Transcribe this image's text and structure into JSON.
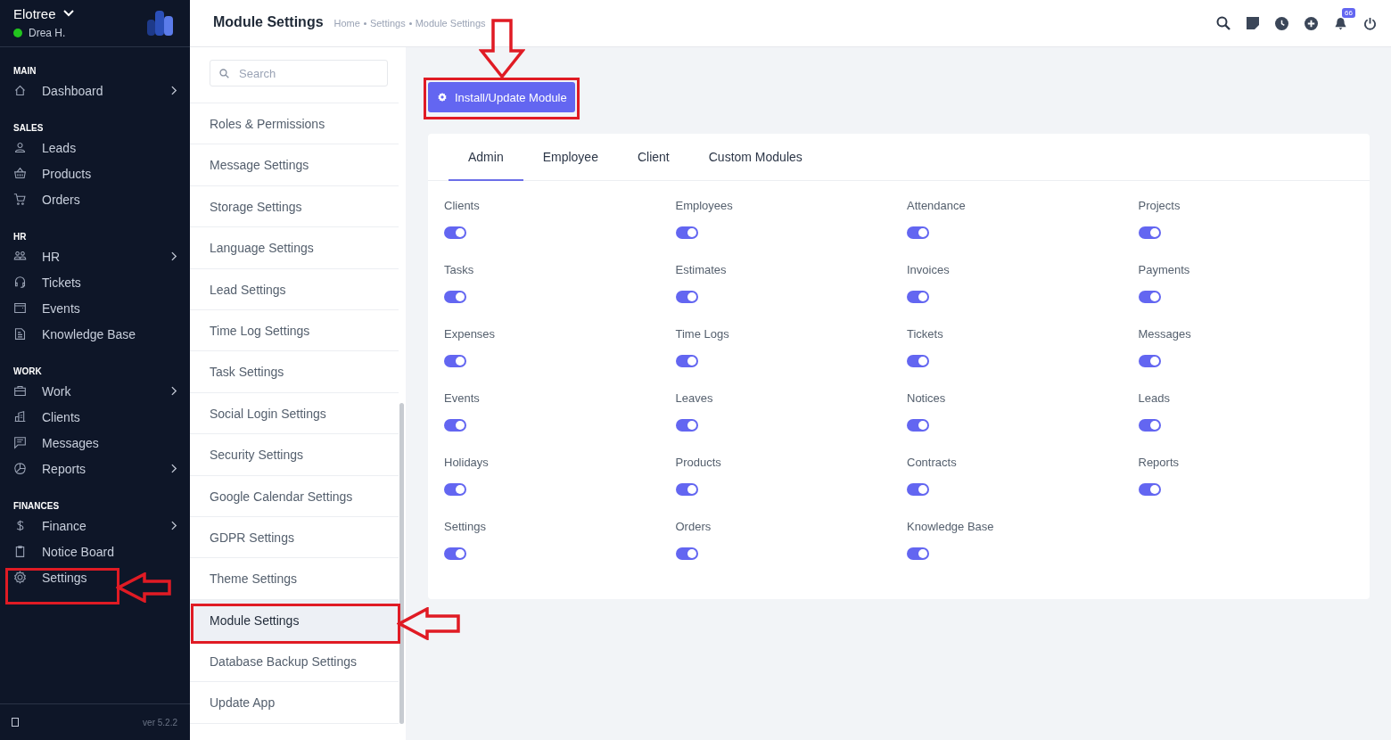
{
  "sidebar": {
    "company": "Elotree",
    "user": "Drea H.",
    "user_online": true,
    "sections": [
      {
        "title": "MAIN",
        "items": [
          {
            "label": "Dashboard",
            "has_submenu": true
          }
        ]
      },
      {
        "title": "SALES",
        "items": [
          {
            "label": "Leads",
            "has_submenu": false
          },
          {
            "label": "Products",
            "has_submenu": false
          },
          {
            "label": "Orders",
            "has_submenu": false
          }
        ]
      },
      {
        "title": "HR",
        "items": [
          {
            "label": "HR",
            "has_submenu": true
          },
          {
            "label": "Tickets",
            "has_submenu": false
          },
          {
            "label": "Events",
            "has_submenu": false
          },
          {
            "label": "Knowledge Base",
            "has_submenu": false
          }
        ]
      },
      {
        "title": "WORK",
        "items": [
          {
            "label": "Work",
            "has_submenu": true
          },
          {
            "label": "Clients",
            "has_submenu": false
          },
          {
            "label": "Messages",
            "has_submenu": false
          },
          {
            "label": "Reports",
            "has_submenu": true
          }
        ]
      },
      {
        "title": "FINANCES",
        "items": [
          {
            "label": "Finance",
            "has_submenu": true
          },
          {
            "label": "Notice Board",
            "has_submenu": false
          },
          {
            "label": "Settings",
            "has_submenu": false
          }
        ]
      }
    ],
    "version": "ver 5.2.2"
  },
  "header": {
    "title": "Module Settings",
    "breadcrumb": [
      "Home",
      "Settings",
      "Module Settings"
    ],
    "notification_count": "66"
  },
  "settings_menu": {
    "search": {
      "placeholder": "Search"
    },
    "items": [
      {
        "label": "Roles & Permissions",
        "selected": false
      },
      {
        "label": "Message Settings",
        "selected": false
      },
      {
        "label": "Storage Settings",
        "selected": false
      },
      {
        "label": "Language Settings",
        "selected": false
      },
      {
        "label": "Lead Settings",
        "selected": false
      },
      {
        "label": "Time Log Settings",
        "selected": false
      },
      {
        "label": "Task Settings",
        "selected": false
      },
      {
        "label": "Social Login Settings",
        "selected": false
      },
      {
        "label": "Security Settings",
        "selected": false
      },
      {
        "label": "Google Calendar Settings",
        "selected": false
      },
      {
        "label": "GDPR Settings",
        "selected": false
      },
      {
        "label": "Theme Settings",
        "selected": false
      },
      {
        "label": "Module Settings",
        "selected": true
      },
      {
        "label": "Database Backup Settings",
        "selected": false
      },
      {
        "label": "Update App",
        "selected": false
      }
    ]
  },
  "install_button": "Install/Update Module",
  "tabs": [
    {
      "label": "Admin",
      "selected": true
    },
    {
      "label": "Employee",
      "selected": false
    },
    {
      "label": "Client",
      "selected": false
    },
    {
      "label": "Custom Modules",
      "selected": false
    }
  ],
  "modules": [
    {
      "name": "Clients",
      "on": true
    },
    {
      "name": "Employees",
      "on": true
    },
    {
      "name": "Attendance",
      "on": true
    },
    {
      "name": "Projects",
      "on": true
    },
    {
      "name": "Tasks",
      "on": true
    },
    {
      "name": "Estimates",
      "on": true
    },
    {
      "name": "Invoices",
      "on": true
    },
    {
      "name": "Payments",
      "on": true
    },
    {
      "name": "Expenses",
      "on": true
    },
    {
      "name": "Time Logs",
      "on": true
    },
    {
      "name": "Tickets",
      "on": true
    },
    {
      "name": "Messages",
      "on": true
    },
    {
      "name": "Events",
      "on": true
    },
    {
      "name": "Leaves",
      "on": true
    },
    {
      "name": "Notices",
      "on": true
    },
    {
      "name": "Leads",
      "on": true
    },
    {
      "name": "Holidays",
      "on": true
    },
    {
      "name": "Products",
      "on": true
    },
    {
      "name": "Contracts",
      "on": true
    },
    {
      "name": "Reports",
      "on": true
    },
    {
      "name": "Settings",
      "on": true
    },
    {
      "name": "Orders",
      "on": true
    },
    {
      "name": "Knowledge Base",
      "on": true
    }
  ]
}
